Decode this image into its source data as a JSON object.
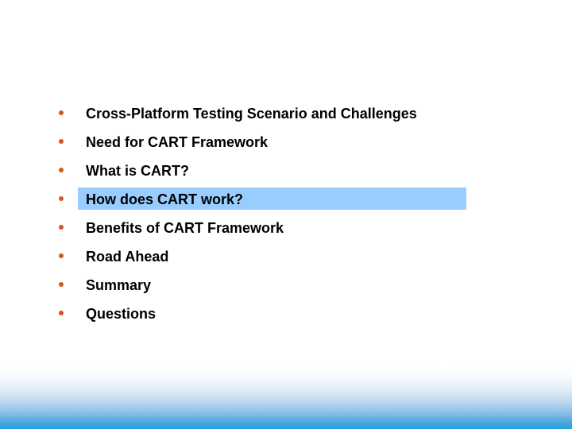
{
  "slide": {
    "agenda": [
      {
        "label": "Cross-Platform Testing Scenario and Challenges",
        "highlighted": false
      },
      {
        "label": "Need for CART Framework",
        "highlighted": false
      },
      {
        "label": "What is CART?",
        "highlighted": false
      },
      {
        "label": "How does CART work?",
        "highlighted": true
      },
      {
        "label": "Benefits of CART Framework",
        "highlighted": false
      },
      {
        "label": "Road Ahead",
        "highlighted": false
      },
      {
        "label": "Summary",
        "highlighted": false
      },
      {
        "label": "Questions",
        "highlighted": false
      }
    ],
    "colors": {
      "bullet": "#d9541e",
      "highlight": "#99ccff",
      "footer_gradient_end": "#27a2e0"
    }
  }
}
